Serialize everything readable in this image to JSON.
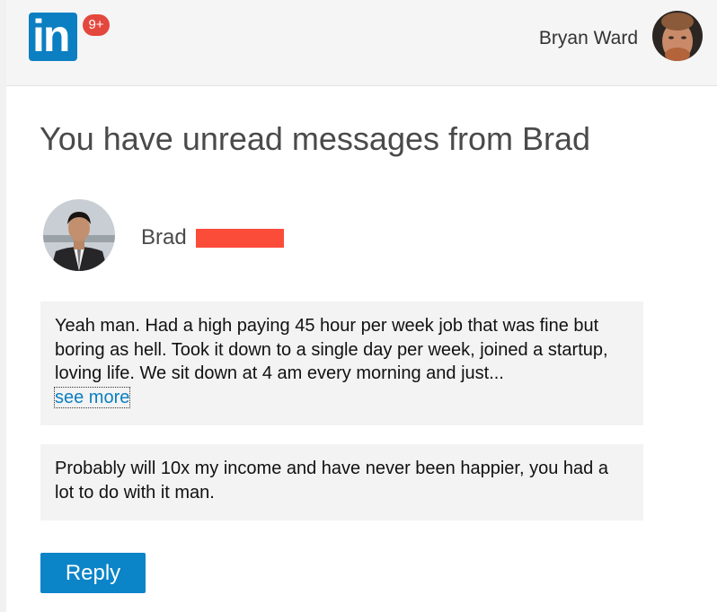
{
  "header": {
    "logo_text": "in",
    "badge": "9+",
    "user_name": "Bryan Ward"
  },
  "email": {
    "title": "You have unread messages from Brad",
    "sender": {
      "first_name": "Brad"
    },
    "messages": [
      {
        "text": "Yeah man. Had a high paying 45 hour per week job that was fine but boring as hell. Took it down to a single day per week, joined a startup, loving life. We sit down at 4 am every morning and just...",
        "link": "see more"
      },
      {
        "text": "Probably will 10x my income and have never been happier, you had a lot to do with it man."
      }
    ],
    "reply_label": "Reply"
  },
  "colors": {
    "brand": "#0b7fc2",
    "badge": "#e4473d",
    "redaction": "#fb4c3a",
    "message_bg": "#f3f3f3"
  }
}
